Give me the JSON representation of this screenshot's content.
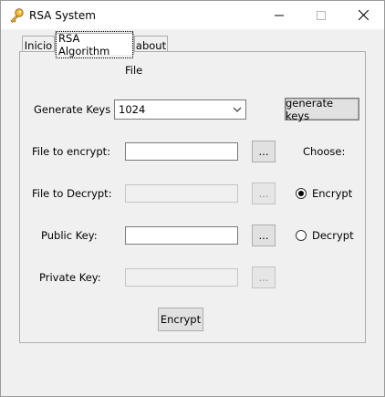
{
  "window": {
    "title": "RSA System",
    "icon": "key-icon"
  },
  "tabs": [
    {
      "label": "Inicio",
      "selected": false
    },
    {
      "label": "RSA Algorithm",
      "selected": true
    },
    {
      "label": "about",
      "selected": false
    }
  ],
  "form": {
    "file_label": "File",
    "generate_keys_label": "Generate Keys",
    "key_size_value": "1024",
    "generate_button": "generate keys",
    "file_to_encrypt_label": "File to encrypt:",
    "file_to_encrypt_value": "",
    "file_to_decrypt_label": "File to Decrypt:",
    "file_to_decrypt_value": "",
    "public_key_label": "Public Key:",
    "public_key_value": "",
    "private_key_label": "Private Key:",
    "private_key_value": "",
    "browse_label": "...",
    "choose_label": "Choose:",
    "radio_encrypt": "Encrypt",
    "radio_decrypt": "Decrypt",
    "selected_mode": "Encrypt",
    "action_button": "Encrypt"
  }
}
